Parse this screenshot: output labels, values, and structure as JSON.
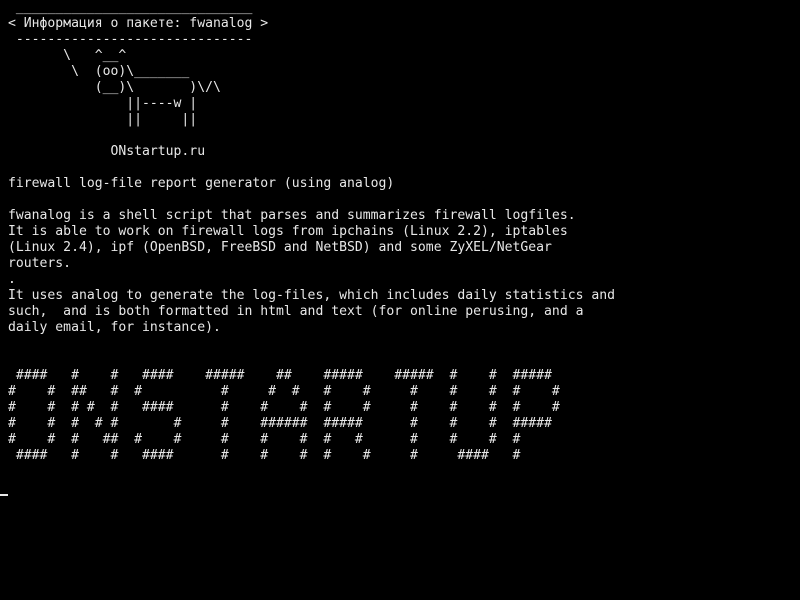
{
  "terminal": {
    "lines": [
      " ______________________________",
      "< Информация о пакете: fwanalog >",
      " ------------------------------",
      "       \\   ^__^",
      "        \\  (oo)\\_______",
      "           (__)\\       )\\/\\",
      "               ||----w |",
      "               ||     ||",
      "",
      "             ONstartup.ru",
      "",
      "firewall log-file report generator (using analog)",
      "",
      "fwanalog is a shell script that parses and summarizes firewall logfiles.",
      "It is able to work on firewall logs from ipchains (Linux 2.2), iptables",
      "(Linux 2.4), ipf (OpenBSD, FreeBSD and NetBSD) and some ZyXEL/NetGear",
      "routers.",
      ".",
      "It uses analog to generate the log-files, which includes daily statistics and",
      "such,  and is both formatted in html and text (for online perusing, and a",
      "daily email, for instance).",
      "",
      "",
      " ####   #    #   ####    #####    ##    #####    #####  #    #  #####",
      "#    #  ##   #  #          #     #  #   #    #     #    #    #  #    #",
      "#    #  # #  #   ####      #    #    #  #    #     #    #    #  #    #",
      "#    #  #  # #       #     #    ######  #####      #    #    #  #####",
      "#    #  #   ##  #    #     #    #    #  #   #      #    #    #  #",
      " ####   #    #   ####      #    #    #  #    #     #     ####   #"
    ],
    "colors": {
      "background": "#000000",
      "foreground": "#e8e8e8"
    }
  }
}
